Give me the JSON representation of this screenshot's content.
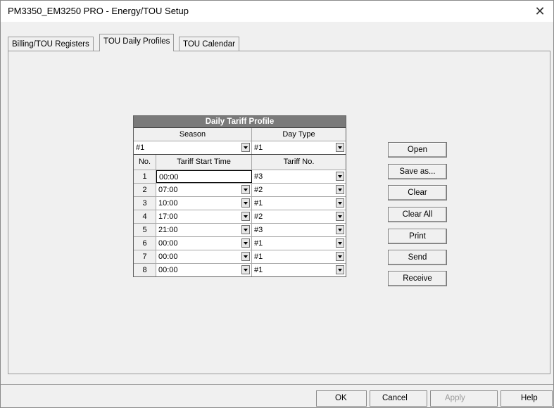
{
  "window": {
    "title": "PM3350_EM3250 PRO - Energy/TOU Setup",
    "close_glyph": "✕"
  },
  "tabs": [
    {
      "label": "Billing/TOU Registers"
    },
    {
      "label": "TOU Daily Profiles"
    },
    {
      "label": "TOU Calendar"
    }
  ],
  "active_tab": "TOU Daily Profiles",
  "profile": {
    "title": "Daily Tariff Profile",
    "season_header": "Season",
    "day_type_header": "Day Type",
    "season_value": "#1",
    "day_type_value": "#1",
    "columns": [
      "No.",
      "Tariff Start Time",
      "Tariff No."
    ],
    "rows": [
      {
        "no": "1",
        "start": "00:00",
        "tariff": "#3"
      },
      {
        "no": "2",
        "start": "07:00",
        "tariff": "#2"
      },
      {
        "no": "3",
        "start": "10:00",
        "tariff": "#1"
      },
      {
        "no": "4",
        "start": "17:00",
        "tariff": "#2"
      },
      {
        "no": "5",
        "start": "21:00",
        "tariff": "#3"
      },
      {
        "no": "6",
        "start": "00:00",
        "tariff": "#1"
      },
      {
        "no": "7",
        "start": "00:00",
        "tariff": "#1"
      },
      {
        "no": "8",
        "start": "00:00",
        "tariff": "#1"
      }
    ]
  },
  "side_buttons": {
    "open": "Open",
    "save_as": "Save as...",
    "clear": "Clear",
    "clear_all": "Clear All",
    "print": "Print",
    "send": "Send",
    "receive": "Receive"
  },
  "footer_buttons": {
    "ok": "OK",
    "cancel": "Cancel",
    "apply": "Apply",
    "help": "Help"
  }
}
